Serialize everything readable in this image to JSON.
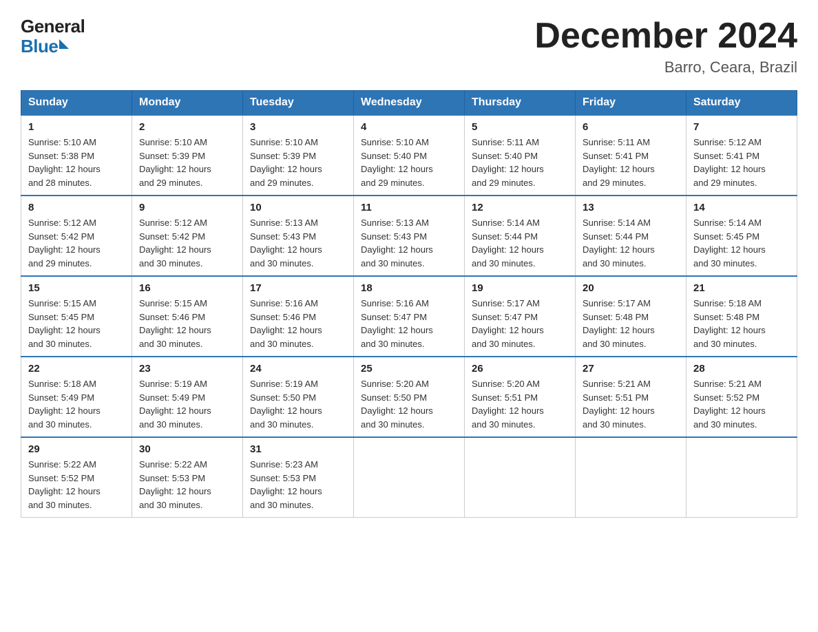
{
  "header": {
    "logo_general": "General",
    "logo_blue": "Blue",
    "title": "December 2024",
    "subtitle": "Barro, Ceara, Brazil"
  },
  "days_of_week": [
    "Sunday",
    "Monday",
    "Tuesday",
    "Wednesday",
    "Thursday",
    "Friday",
    "Saturday"
  ],
  "weeks": [
    [
      {
        "day": "1",
        "sunrise": "5:10 AM",
        "sunset": "5:38 PM",
        "daylight": "12 hours and 28 minutes."
      },
      {
        "day": "2",
        "sunrise": "5:10 AM",
        "sunset": "5:39 PM",
        "daylight": "12 hours and 29 minutes."
      },
      {
        "day": "3",
        "sunrise": "5:10 AM",
        "sunset": "5:39 PM",
        "daylight": "12 hours and 29 minutes."
      },
      {
        "day": "4",
        "sunrise": "5:10 AM",
        "sunset": "5:40 PM",
        "daylight": "12 hours and 29 minutes."
      },
      {
        "day": "5",
        "sunrise": "5:11 AM",
        "sunset": "5:40 PM",
        "daylight": "12 hours and 29 minutes."
      },
      {
        "day": "6",
        "sunrise": "5:11 AM",
        "sunset": "5:41 PM",
        "daylight": "12 hours and 29 minutes."
      },
      {
        "day": "7",
        "sunrise": "5:12 AM",
        "sunset": "5:41 PM",
        "daylight": "12 hours and 29 minutes."
      }
    ],
    [
      {
        "day": "8",
        "sunrise": "5:12 AM",
        "sunset": "5:42 PM",
        "daylight": "12 hours and 29 minutes."
      },
      {
        "day": "9",
        "sunrise": "5:12 AM",
        "sunset": "5:42 PM",
        "daylight": "12 hours and 30 minutes."
      },
      {
        "day": "10",
        "sunrise": "5:13 AM",
        "sunset": "5:43 PM",
        "daylight": "12 hours and 30 minutes."
      },
      {
        "day": "11",
        "sunrise": "5:13 AM",
        "sunset": "5:43 PM",
        "daylight": "12 hours and 30 minutes."
      },
      {
        "day": "12",
        "sunrise": "5:14 AM",
        "sunset": "5:44 PM",
        "daylight": "12 hours and 30 minutes."
      },
      {
        "day": "13",
        "sunrise": "5:14 AM",
        "sunset": "5:44 PM",
        "daylight": "12 hours and 30 minutes."
      },
      {
        "day": "14",
        "sunrise": "5:14 AM",
        "sunset": "5:45 PM",
        "daylight": "12 hours and 30 minutes."
      }
    ],
    [
      {
        "day": "15",
        "sunrise": "5:15 AM",
        "sunset": "5:45 PM",
        "daylight": "12 hours and 30 minutes."
      },
      {
        "day": "16",
        "sunrise": "5:15 AM",
        "sunset": "5:46 PM",
        "daylight": "12 hours and 30 minutes."
      },
      {
        "day": "17",
        "sunrise": "5:16 AM",
        "sunset": "5:46 PM",
        "daylight": "12 hours and 30 minutes."
      },
      {
        "day": "18",
        "sunrise": "5:16 AM",
        "sunset": "5:47 PM",
        "daylight": "12 hours and 30 minutes."
      },
      {
        "day": "19",
        "sunrise": "5:17 AM",
        "sunset": "5:47 PM",
        "daylight": "12 hours and 30 minutes."
      },
      {
        "day": "20",
        "sunrise": "5:17 AM",
        "sunset": "5:48 PM",
        "daylight": "12 hours and 30 minutes."
      },
      {
        "day": "21",
        "sunrise": "5:18 AM",
        "sunset": "5:48 PM",
        "daylight": "12 hours and 30 minutes."
      }
    ],
    [
      {
        "day": "22",
        "sunrise": "5:18 AM",
        "sunset": "5:49 PM",
        "daylight": "12 hours and 30 minutes."
      },
      {
        "day": "23",
        "sunrise": "5:19 AM",
        "sunset": "5:49 PM",
        "daylight": "12 hours and 30 minutes."
      },
      {
        "day": "24",
        "sunrise": "5:19 AM",
        "sunset": "5:50 PM",
        "daylight": "12 hours and 30 minutes."
      },
      {
        "day": "25",
        "sunrise": "5:20 AM",
        "sunset": "5:50 PM",
        "daylight": "12 hours and 30 minutes."
      },
      {
        "day": "26",
        "sunrise": "5:20 AM",
        "sunset": "5:51 PM",
        "daylight": "12 hours and 30 minutes."
      },
      {
        "day": "27",
        "sunrise": "5:21 AM",
        "sunset": "5:51 PM",
        "daylight": "12 hours and 30 minutes."
      },
      {
        "day": "28",
        "sunrise": "5:21 AM",
        "sunset": "5:52 PM",
        "daylight": "12 hours and 30 minutes."
      }
    ],
    [
      {
        "day": "29",
        "sunrise": "5:22 AM",
        "sunset": "5:52 PM",
        "daylight": "12 hours and 30 minutes."
      },
      {
        "day": "30",
        "sunrise": "5:22 AM",
        "sunset": "5:53 PM",
        "daylight": "12 hours and 30 minutes."
      },
      {
        "day": "31",
        "sunrise": "5:23 AM",
        "sunset": "5:53 PM",
        "daylight": "12 hours and 30 minutes."
      },
      null,
      null,
      null,
      null
    ]
  ]
}
